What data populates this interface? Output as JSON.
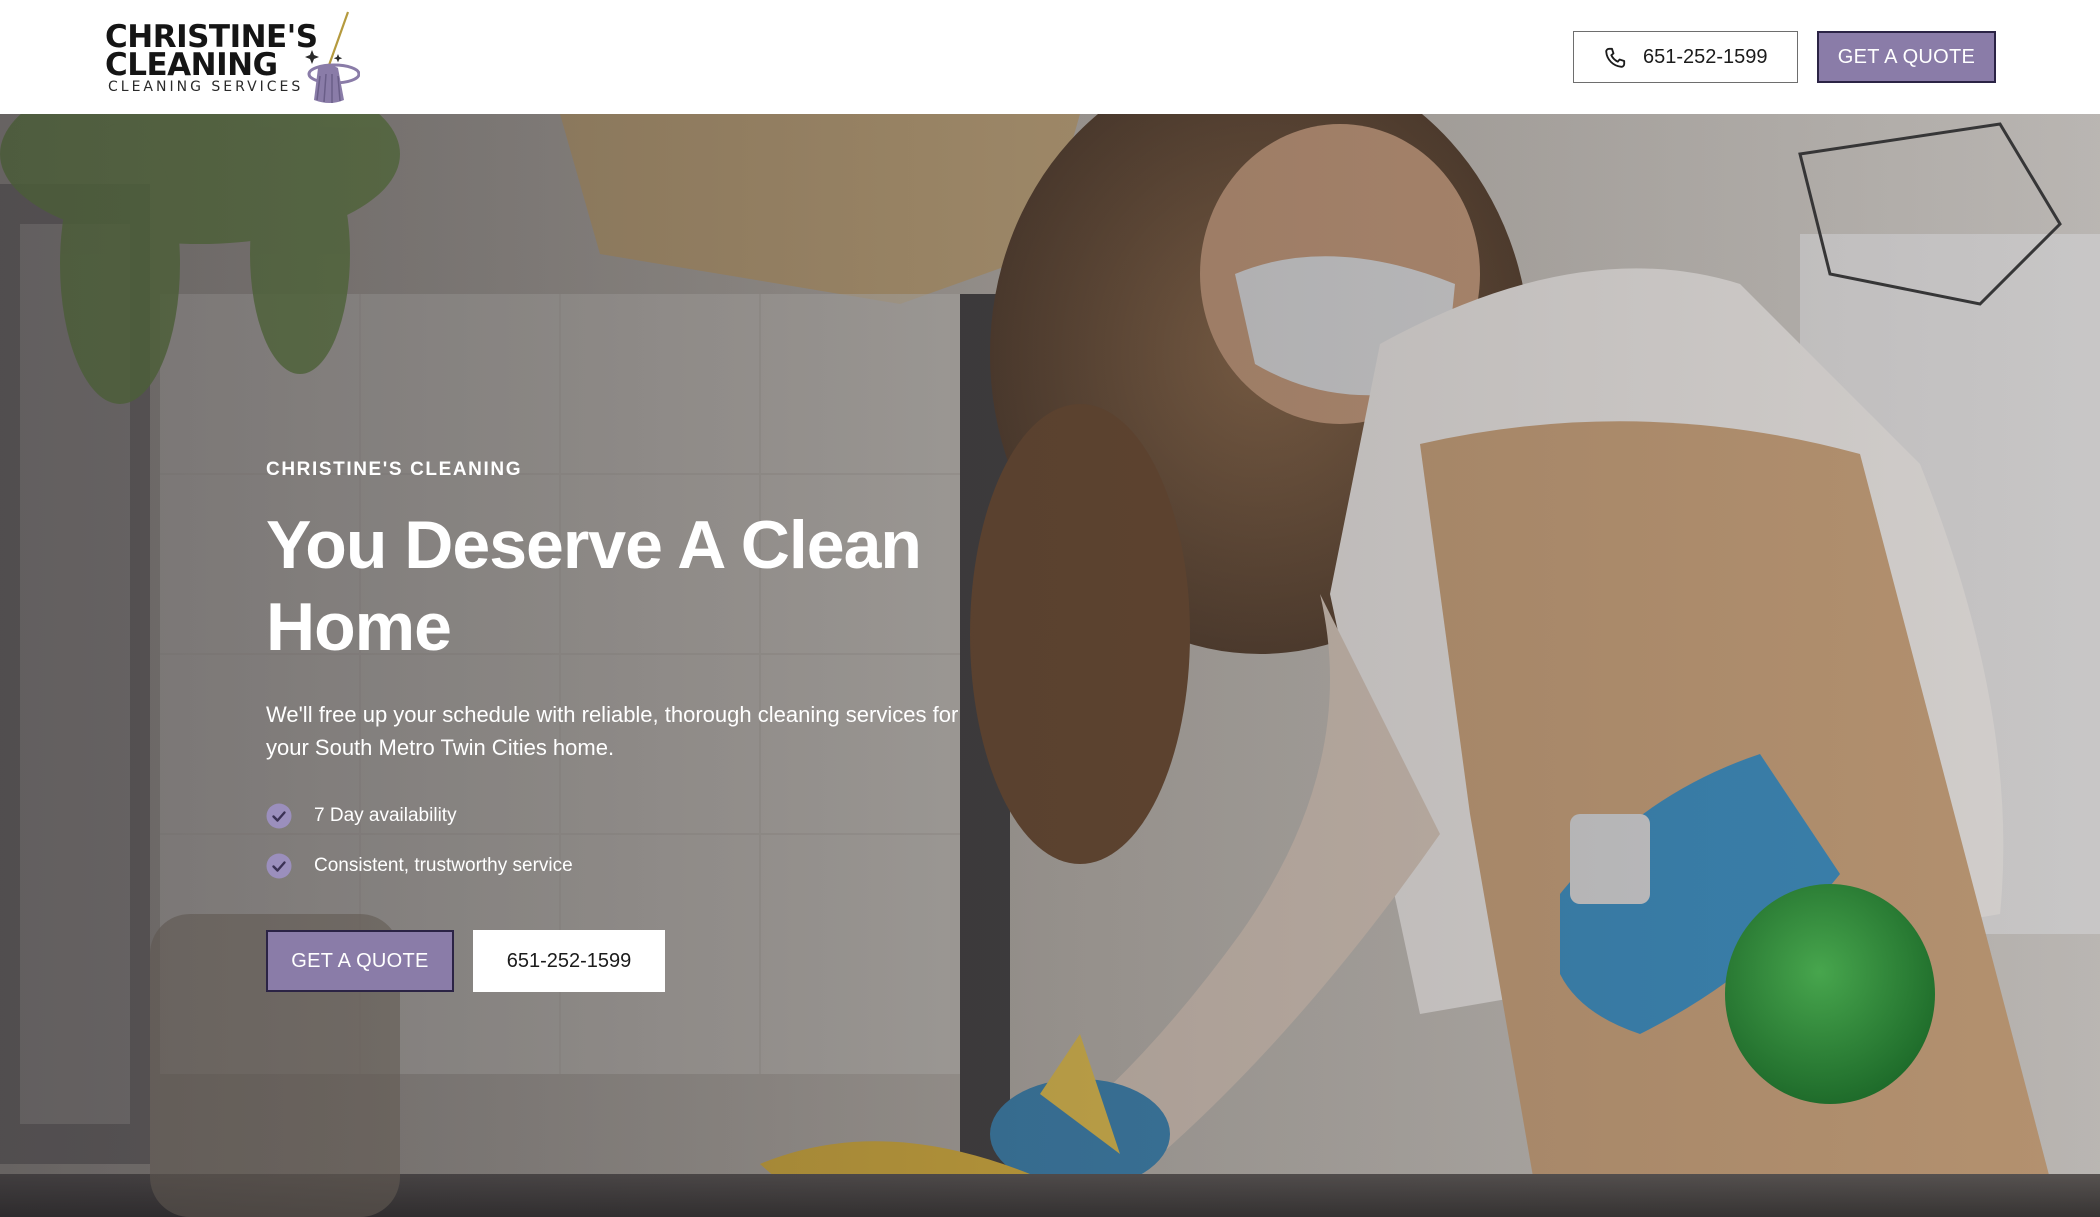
{
  "brand": {
    "line1": "CHRISTINE'S",
    "line2": "CLEANING",
    "tagline": "CLEANING SERVICES",
    "accent_color": "#8a7ca8"
  },
  "header": {
    "phone_label": "651-252-1599",
    "phone_icon": "phone-icon",
    "quote_label": "GET A QUOTE"
  },
  "hero": {
    "eyebrow": "CHRISTINE'S CLEANING",
    "headline": "You Deserve A Clean Home",
    "subtext": "We'll free up your schedule with reliable, thorough cleaning services for your South Metro Twin Cities home.",
    "features": [
      {
        "icon": "check-circle-icon",
        "label": "7 Day availability"
      },
      {
        "icon": "check-circle-icon",
        "label": "Consistent, trustworthy service"
      }
    ],
    "cta_quote": "GET A QUOTE",
    "cta_phone": "651-252-1599"
  }
}
